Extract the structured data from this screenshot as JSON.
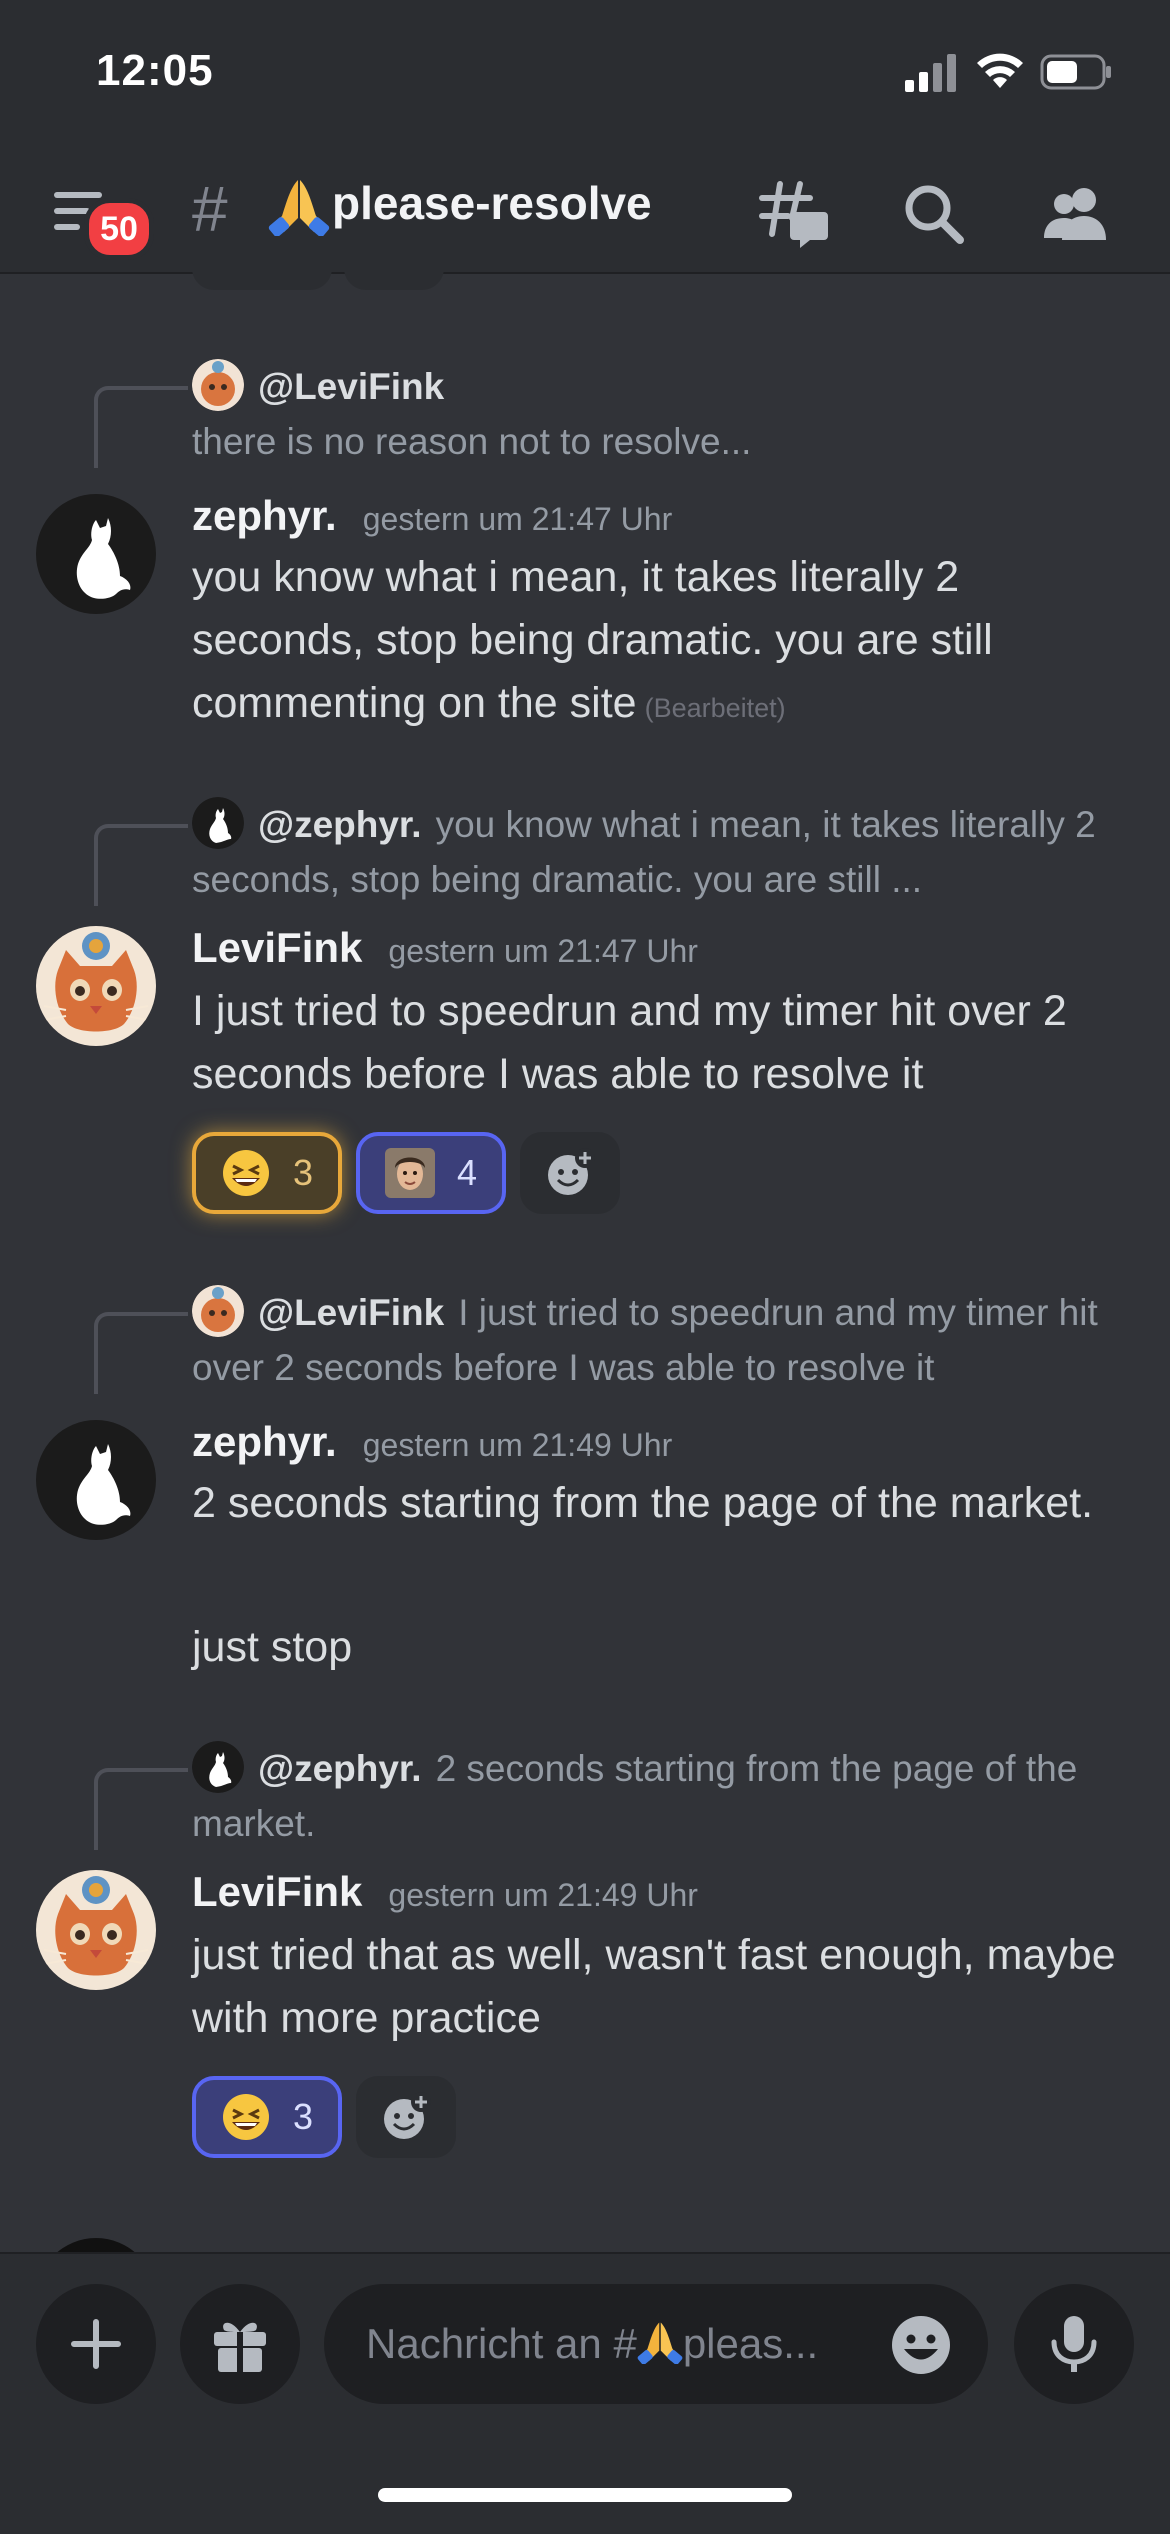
{
  "status_bar": {
    "time": "12:05"
  },
  "header": {
    "notification_count": "50",
    "channel_prefix": "#",
    "channel_name": "please-resolve",
    "channel_emoji": "folded-hands"
  },
  "messages": [
    {
      "reply_to": {
        "mention": "@LeviFink",
        "text": "there is no reason not to resolve..."
      },
      "author": "zephyr.",
      "timestamp": "gestern um 21:47 Uhr",
      "lines": [
        "you know what i mean, it takes literally 2 seconds, stop being dramatic. you are still commenting on the site"
      ],
      "edited": "(Bearbeitet)"
    },
    {
      "reply_to": {
        "mention": "@zephyr.",
        "text": "you know what i mean, it takes literally 2 seconds, stop being dramatic. you are still ..."
      },
      "author": "LeviFink",
      "timestamp": "gestern um 21:47 Uhr",
      "lines": [
        "I just tried to speedrun and my timer hit over 2 seconds before I was able to resolve it"
      ],
      "reactions": [
        {
          "emoji": "laughing-face",
          "count": "3"
        },
        {
          "emoji": "person-avatar",
          "count": "4"
        }
      ]
    },
    {
      "reply_to": {
        "mention": "@LeviFink",
        "text": "I just tried to speedrun and my timer hit over 2 seconds before I was able to resolve it"
      },
      "author": "zephyr.",
      "timestamp": "gestern um 21:49 Uhr",
      "lines": [
        "2 seconds starting from the page of the market.",
        "just stop"
      ]
    },
    {
      "reply_to": {
        "mention": "@zephyr.",
        "text": "2 seconds starting from the page of the market."
      },
      "author": "LeviFink",
      "timestamp": "gestern um 21:49 Uhr",
      "lines": [
        "just tried that as well, wasn't fast enough, maybe with more practice"
      ],
      "reactions": [
        {
          "emoji": "laughing-face",
          "count": "3"
        }
      ]
    }
  ],
  "composer": {
    "placeholder_prefix": "Nachricht an #",
    "placeholder_suffix": "pleas..."
  },
  "colors": {
    "accent": "#5865f2",
    "mention_badge": "#f23f43",
    "background": "#313338"
  }
}
